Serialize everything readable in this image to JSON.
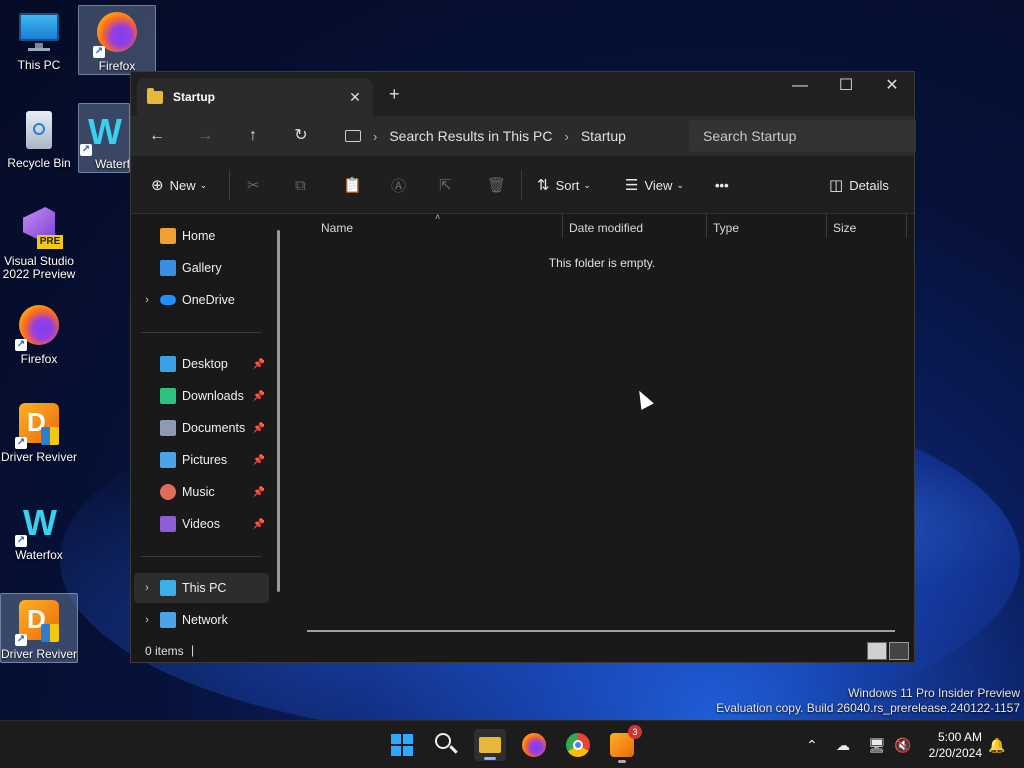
{
  "desktop": {
    "icons": [
      {
        "label": "This PC",
        "icon": "monitor-icon"
      },
      {
        "label": "Firefox",
        "icon": "firefox-icon"
      },
      {
        "label": "Recycle Bin",
        "icon": "recycle-bin-icon"
      },
      {
        "label": "Waterf",
        "icon": "waterfox-icon"
      },
      {
        "label": "Visual Studio 2022 Preview",
        "icon": "visual-studio-icon",
        "badge": "PRE"
      },
      {
        "label": "Firefox",
        "icon": "firefox-icon"
      },
      {
        "label": "Driver Reviver",
        "icon": "driver-reviver-icon"
      },
      {
        "label": "Waterfox",
        "icon": "waterfox-icon"
      },
      {
        "label": "Driver Reviver",
        "icon": "driver-reviver-icon"
      }
    ]
  },
  "explorer": {
    "tab_title": "Startup",
    "tab_close": "✕",
    "new_tab": "+",
    "window_controls": {
      "minimize": "—",
      "maximize": "☐",
      "close": "✕"
    },
    "nav": {
      "back": "←",
      "forward": "→",
      "up": "↑",
      "refresh": "↻"
    },
    "breadcrumb": [
      "Search Results in This PC",
      "Startup"
    ],
    "search_placeholder": "Search Startup",
    "toolbar": {
      "new_label": "New",
      "sort_label": "Sort",
      "view_label": "View",
      "more": "•••",
      "details_label": "Details"
    },
    "sidebar": {
      "top": [
        {
          "label": "Home",
          "icon": "home-icon",
          "color": "#f0a030"
        },
        {
          "label": "Gallery",
          "icon": "gallery-icon",
          "color": "#3a8ee6"
        },
        {
          "label": "OneDrive",
          "icon": "onedrive-icon",
          "color": "#1e90ff",
          "expandable": true
        }
      ],
      "pinned": [
        {
          "label": "Desktop",
          "icon": "desktop-icon",
          "color": "#3aa0e6"
        },
        {
          "label": "Downloads",
          "icon": "downloads-icon",
          "color": "#2ec27e"
        },
        {
          "label": "Documents",
          "icon": "documents-icon",
          "color": "#8a9bb3"
        },
        {
          "label": "Pictures",
          "icon": "pictures-icon",
          "color": "#4aa3e8"
        },
        {
          "label": "Music",
          "icon": "music-icon",
          "color": "#e06c5a"
        },
        {
          "label": "Videos",
          "icon": "videos-icon",
          "color": "#8e5fd9"
        }
      ],
      "bottom": [
        {
          "label": "This PC",
          "icon": "this-pc-icon",
          "color": "#3ab0e6",
          "expandable": true,
          "selected": true
        },
        {
          "label": "Network",
          "icon": "network-icon",
          "color": "#4aa3e8",
          "expandable": true
        }
      ]
    },
    "columns": [
      "Name",
      "Date modified",
      "Type",
      "Size"
    ],
    "empty_message": "This folder is empty.",
    "status": "0 items"
  },
  "watermark": {
    "line1": "Windows 11 Pro Insider Preview",
    "line2": "Evaluation copy. Build 26040.rs_prerelease.240122-1157"
  },
  "taskbar": {
    "time": "5:00 AM",
    "date": "2/20/2024",
    "driver_reviver_badge": "3"
  }
}
